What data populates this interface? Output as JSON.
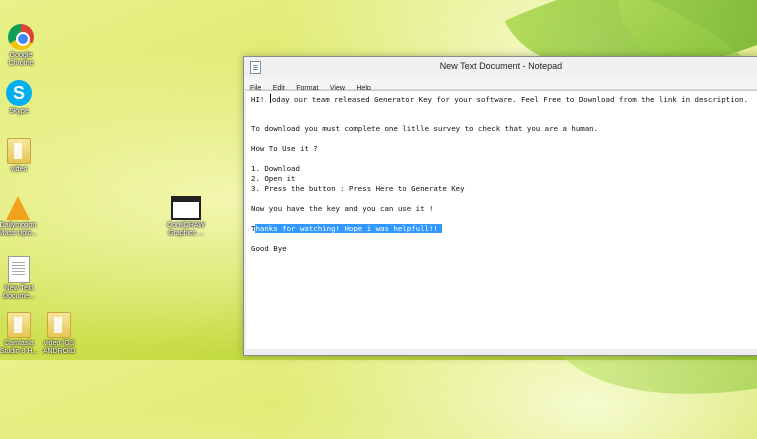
{
  "desktop": {
    "icons": [
      {
        "label": "Google\nChrome",
        "icon": "chrome-icon"
      },
      {
        "label": "Skype",
        "icon": "skype-icon"
      },
      {
        "label": "video",
        "icon": "folder-icon"
      },
      {
        "label": "Dailymotion\nMass Uplo...",
        "icon": "dailymotion-uploader-icon"
      },
      {
        "label": "New Text\nDocume...",
        "icon": "text-document-icon"
      },
      {
        "label": "Camtasia\nStudio 8 H...",
        "icon": "folder-icon"
      },
      {
        "label": "video IOS\nANDROID",
        "icon": "folder-icon"
      },
      {
        "label": "CorelDRAW\nGraphics ...",
        "icon": "application-icon"
      }
    ]
  },
  "notepad": {
    "title": "New Text Document - Notepad",
    "menu": [
      "File",
      "Edit",
      "Format",
      "View",
      "Help"
    ],
    "lines": {
      "l1_pre": "HI! ",
      "l1_post": "oday our team released Generator Key for your software. Feel Free to Download from the link in description.",
      "l4": "To download you must complete one litlle survey to check that you are a human.",
      "l6": "How To Use it ?",
      "l8": "1. Download",
      "l9": "2. Open it",
      "l10": "3. Press the button : Press Here to Generate Key",
      "l12": "Now you have the key and you can use it !",
      "l14_pre": "T",
      "l14_sel": "hanks for watching! Hope i was helpfull!! ",
      "l16": "Good Bye"
    }
  }
}
